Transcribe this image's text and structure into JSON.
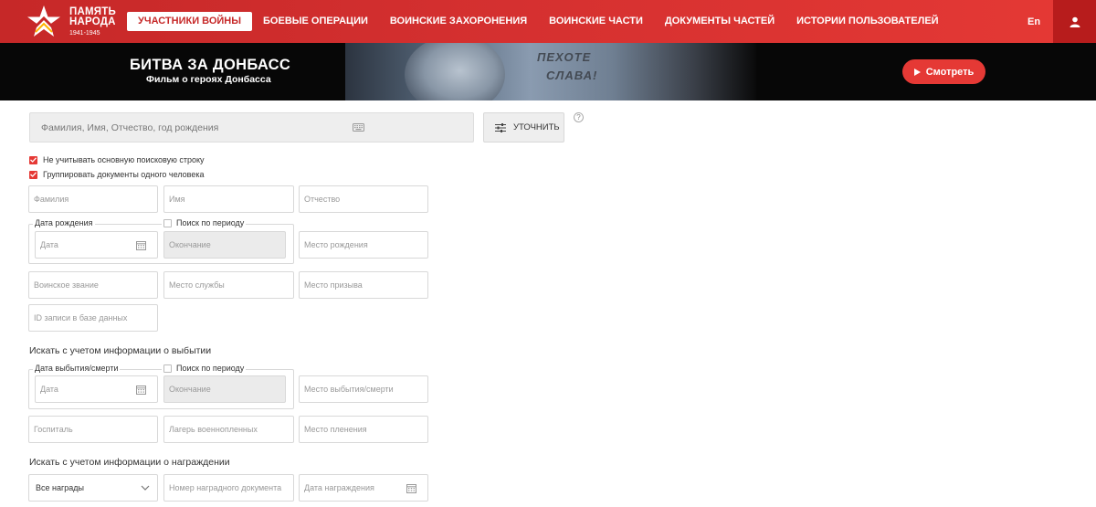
{
  "header": {
    "logo": {
      "line1": "ПАМЯТЬ",
      "line2": "НАРОДА",
      "years": "1941-1945"
    },
    "nav": [
      {
        "label": "УЧАСТНИКИ ВОЙНЫ",
        "active": true
      },
      {
        "label": "БОЕВЫЕ ОПЕРАЦИИ",
        "active": false
      },
      {
        "label": "ВОИНСКИЕ ЗАХОРОНЕНИЯ",
        "active": false
      },
      {
        "label": "ВОИНСКИЕ ЧАСТИ",
        "active": false
      },
      {
        "label": "ДОКУМЕНТЫ ЧАСТЕЙ",
        "active": false
      },
      {
        "label": "ИСТОРИИ ПОЛЬЗОВАТЕЛЕЙ",
        "active": false
      }
    ],
    "lang": "En",
    "user_icon": "user-icon"
  },
  "banner": {
    "title": "БИТВА ЗА ДОНБАСС",
    "subtitle": "Фильм о героях Донбасса",
    "engraving_line1": "ПЕХОТЕ",
    "engraving_line2": "СЛАВА!",
    "watch_label": "Смотреть"
  },
  "search": {
    "placeholder": "Фамилия, Имя, Отчество, год рождения",
    "refine_label": "УТОЧНИТЬ",
    "help": "?"
  },
  "options": {
    "ignore_main": "Не учитывать основную поисковую строку",
    "group_docs": "Группировать документы одного человека"
  },
  "fields": {
    "surname": "Фамилия",
    "name": "Имя",
    "patronymic": "Отчество",
    "birth_date_legend": "Дата рождения",
    "period_search": "Поиск по периоду",
    "date": "Дата",
    "end": "Окончание",
    "birth_place": "Место рождения",
    "rank": "Воинское звание",
    "service_place": "Место службы",
    "draft_place": "Место призыва",
    "record_id": "ID записи в базе данных"
  },
  "departure": {
    "title": "Искать с учетом информации о выбытии",
    "date_legend": "Дата выбытия/смерти",
    "period_search": "Поиск по периоду",
    "date": "Дата",
    "end": "Окончание",
    "place": "Место выбытия/смерти",
    "hospital": "Госпиталь",
    "pow_camp": "Лагерь военнопленных",
    "capture_place": "Место пленения"
  },
  "awards": {
    "title": "Искать с учетом информации о награждении",
    "select_value": "Все награды",
    "doc_number": "Номер наградного документа",
    "award_date": "Дата награждения"
  },
  "colors": {
    "brand_red": "#d32f2f",
    "accent": "#e53935"
  }
}
